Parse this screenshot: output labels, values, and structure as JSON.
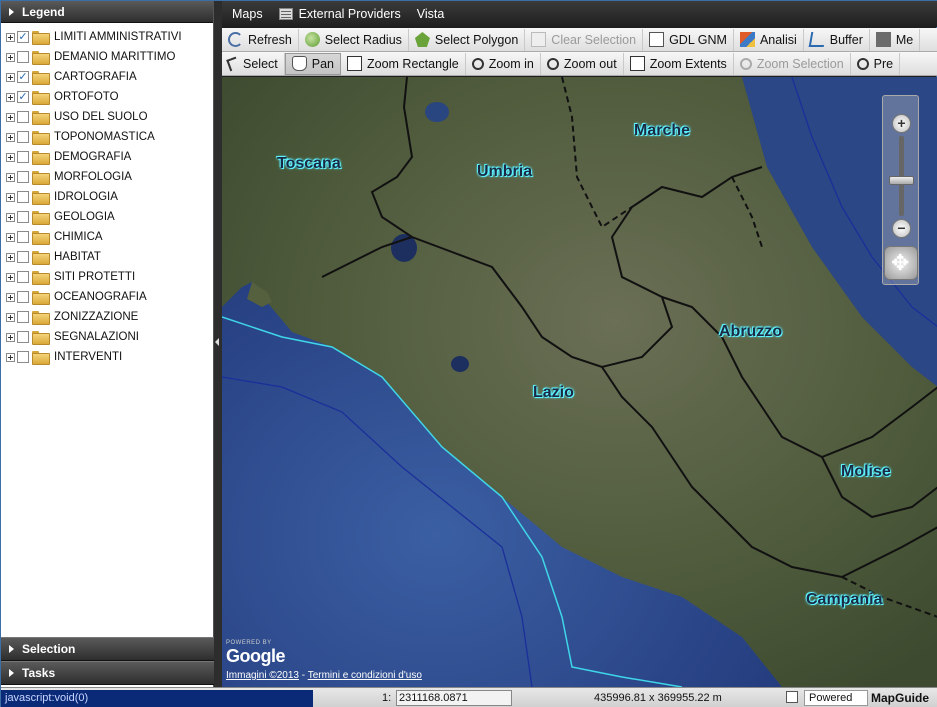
{
  "legend": {
    "title": "Legend",
    "layers": [
      {
        "label": "LIMITI AMMINISTRATIVI",
        "checked": true
      },
      {
        "label": "DEMANIO MARITTIMO",
        "checked": false
      },
      {
        "label": "CARTOGRAFIA",
        "checked": true
      },
      {
        "label": "ORTOFOTO",
        "checked": true
      },
      {
        "label": "USO DEL SUOLO",
        "checked": false
      },
      {
        "label": "TOPONOMASTICA",
        "checked": false
      },
      {
        "label": "DEMOGRAFIA",
        "checked": false
      },
      {
        "label": "MORFOLOGIA",
        "checked": false
      },
      {
        "label": "IDROLOGIA",
        "checked": false
      },
      {
        "label": "GEOLOGIA",
        "checked": false
      },
      {
        "label": "CHIMICA",
        "checked": false
      },
      {
        "label": "HABITAT",
        "checked": false
      },
      {
        "label": "SITI PROTETTI",
        "checked": false
      },
      {
        "label": "OCEANOGRAFIA",
        "checked": false
      },
      {
        "label": "ZONIZZAZIONE",
        "checked": false
      },
      {
        "label": "SEGNALAZIONI",
        "checked": false
      },
      {
        "label": "INTERVENTI",
        "checked": false
      }
    ]
  },
  "panels": {
    "selection": "Selection",
    "tasks": "Tasks"
  },
  "menubar": {
    "maps": "Maps",
    "external_providers": "External Providers",
    "vista": "Vista"
  },
  "toolbar1": {
    "refresh": "Refresh",
    "select_radius": "Select Radius",
    "select_polygon": "Select Polygon",
    "clear_selection": "Clear Selection",
    "gdl_gnm": "GDL GNM",
    "analisi": "Analisi",
    "buffer": "Buffer",
    "measure": "Me"
  },
  "toolbar2": {
    "select": "Select",
    "pan": "Pan",
    "zoom_rectangle": "Zoom Rectangle",
    "zoom_in": "Zoom in",
    "zoom_out": "Zoom out",
    "zoom_extents": "Zoom Extents",
    "zoom_selection": "Zoom Selection",
    "prev": "Pre"
  },
  "map": {
    "regions": [
      "Toscana",
      "Umbria",
      "Marche",
      "Abruzzo",
      "Lazio",
      "Molise",
      "Campania"
    ],
    "zoom_in_glyph": "+",
    "zoom_out_glyph": "−",
    "google_powered": "POWERED BY",
    "google_logo": "Google",
    "attribution_images": "Immagini ©2013",
    "attribution_separator": " - ",
    "attribution_terms": "Termini e condizioni d'uso",
    "colors": {
      "sea": "#27407a",
      "land": "#4e5a3e",
      "boundary": "#111111",
      "coast_line": "#3fd6e8",
      "label_glow": "#5ef3ff"
    }
  },
  "statusbar": {
    "link": "javascript:void(0)",
    "scale_label": "1:",
    "scale_value": "2311168.0871",
    "extent": "435996.81 x 369955.22  m",
    "powered_by": "Powered by",
    "mapguide": "MapGuide"
  }
}
